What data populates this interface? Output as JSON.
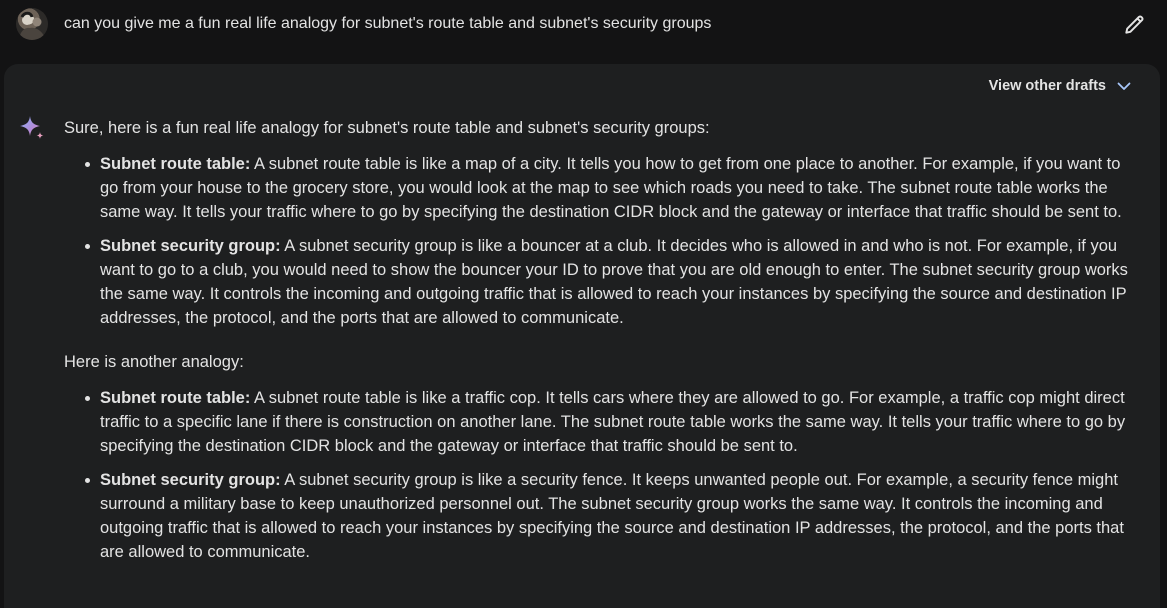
{
  "prompt": {
    "text": "can you give me a fun real life analogy for subnet's route table and subnet's security groups"
  },
  "icons": {
    "avatar": "user-avatar",
    "edit": "pencil-icon",
    "drafts_chevron": "chevron-down-icon",
    "assistant": "sparkle-icon"
  },
  "colors": {
    "background": "#131314",
    "card": "#1e1f20",
    "text": "#e3e3e3",
    "sparkle_blue": "#8ab4f8",
    "sparkle_pink": "#e8a0bf"
  },
  "response": {
    "drafts_label": "View other drafts",
    "intro": "Sure, here is a fun real life analogy for subnet's route table and subnet's security groups:",
    "first_list": [
      {
        "term": "Subnet route table:",
        "text": " A subnet route table is like a map of a city. It tells you how to get from one place to another. For example, if you want to go from your house to the grocery store, you would look at the map to see which roads you need to take. The subnet route table works the same way. It tells your traffic where to go by specifying the destination CIDR block and the gateway or interface that traffic should be sent to."
      },
      {
        "term": "Subnet security group:",
        "text": " A subnet security group is like a bouncer at a club. It decides who is allowed in and who is not. For example, if you want to go to a club, you would need to show the bouncer your ID to prove that you are old enough to enter. The subnet security group works the same way. It controls the incoming and outgoing traffic that is allowed to reach your instances by specifying the source and destination IP addresses, the protocol, and the ports that are allowed to communicate."
      }
    ],
    "another_label": "Here is another analogy:",
    "second_list": [
      {
        "term": "Subnet route table:",
        "text": " A subnet route table is like a traffic cop. It tells cars where they are allowed to go. For example, a traffic cop might direct traffic to a specific lane if there is construction on another lane. The subnet route table works the same way. It tells your traffic where to go by specifying the destination CIDR block and the gateway or interface that traffic should be sent to."
      },
      {
        "term": "Subnet security group:",
        "text": " A subnet security group is like a security fence. It keeps unwanted people out. For example, a security fence might surround a military base to keep unauthorized personnel out. The subnet security group works the same way. It controls the incoming and outgoing traffic that is allowed to reach your instances by specifying the source and destination IP addresses, the protocol, and the ports that are allowed to communicate."
      }
    ]
  }
}
